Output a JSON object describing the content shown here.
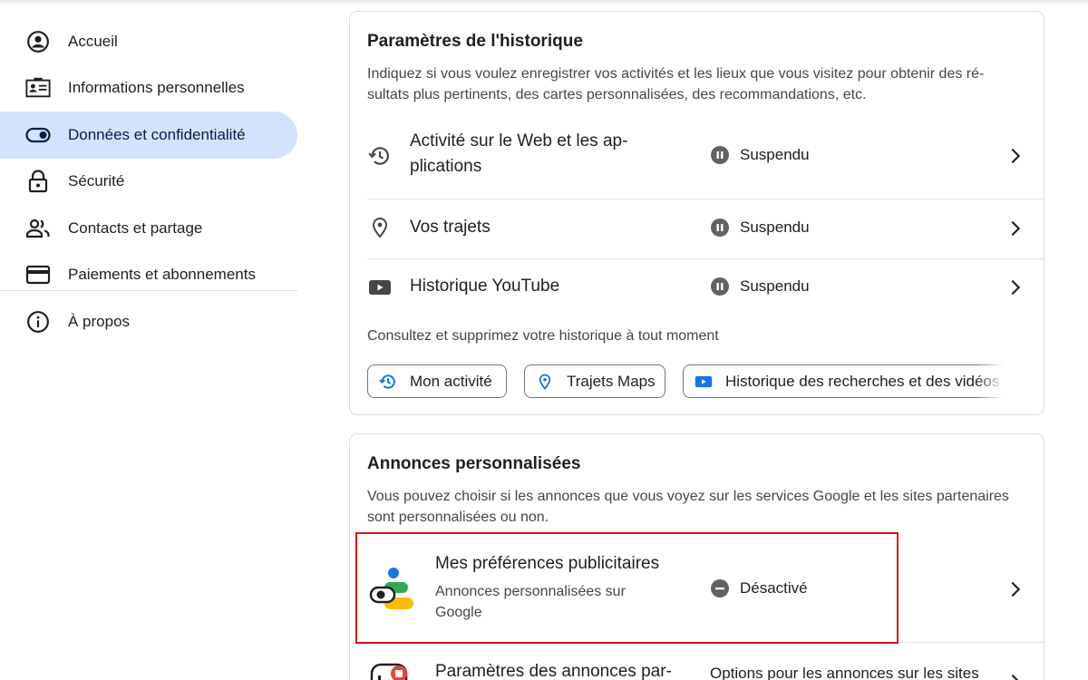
{
  "sidebar": {
    "items": [
      {
        "label": "Accueil",
        "icon": "account-circle-icon"
      },
      {
        "label": "Informations personnelles",
        "icon": "id-card-icon"
      },
      {
        "label": "Données et confidentialité",
        "icon": "toggle-icon",
        "active": true
      },
      {
        "label": "Sécurité",
        "icon": "lock-icon"
      },
      {
        "label": "Contacts et partage",
        "icon": "people-icon"
      },
      {
        "label": "Paiements et abonnements",
        "icon": "credit-card-icon"
      }
    ],
    "about": {
      "label": "À propos",
      "icon": "info-icon"
    }
  },
  "history": {
    "title": "Paramètres de l'historique",
    "description": "Indiquez si vous voulez enregistrer vos activités et les lieux que vous visitez pour obtenir des ré­sultats plus pertinents, des cartes personnalisées, des recommandations, etc.",
    "rows": [
      {
        "label": "Activité sur le Web et les ap­plications",
        "status": "Suspendu",
        "icon": "history-icon"
      },
      {
        "label": "Vos trajets",
        "status": "Suspendu",
        "icon": "location-pin-icon"
      },
      {
        "label": "Historique YouTube",
        "status": "Suspendu",
        "icon": "youtube-icon"
      }
    ],
    "hint": "Consultez et supprimez votre historique à tout moment",
    "chips": [
      {
        "label": "Mon activité",
        "icon": "history-icon"
      },
      {
        "label": "Trajets Maps",
        "icon": "maps-pin-icon"
      },
      {
        "label": "Historique des recherches et des vidéos re",
        "icon": "youtube-icon"
      }
    ]
  },
  "ads": {
    "title": "Annonces personnalisées",
    "description": "Vous pouvez choisir si les annonces que vous voyez sur les services Google et les sites parte­naires sont personnalisées ou non.",
    "rows": [
      {
        "label": "Mes préférences publicitaires",
        "sublabel": "Annonces personnalisées sur Google",
        "status": "Désactivé",
        "icon": "ad-preferences-icon"
      },
      {
        "label": "Paramètres des annonces par-",
        "status": "Options pour les annonces sur les sites",
        "icon": "partner-ads-icon"
      }
    ]
  },
  "colors": {
    "active_bg": "#d3e3fd",
    "highlight": "#d3141e",
    "status_icon": "#5f6368",
    "link_blue": "#1a73e8"
  }
}
